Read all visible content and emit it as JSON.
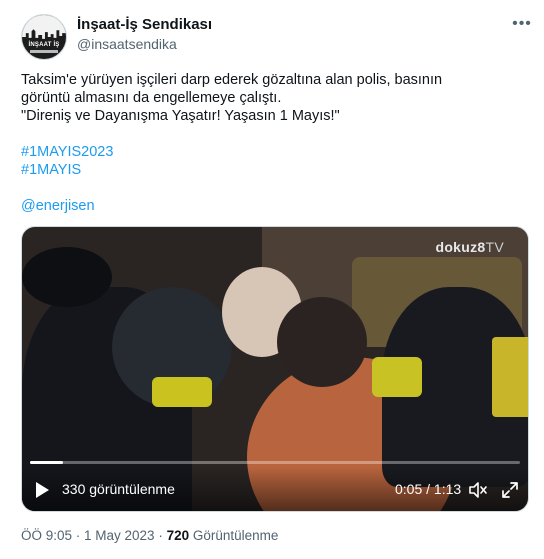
{
  "author": {
    "display_name": "İnşaat-İş Sendikası",
    "handle": "@insaatsendika",
    "avatar_label": "İNŞAAT İŞ"
  },
  "more_icon": "more-dots-icon",
  "tweet": {
    "line1": "Taksim'e yürüyen  işçileri darp ederek gözaltına alan polis, basının",
    "line2": "görüntü almasını da engellemeye çalıştı.",
    "line3": "\"Direniş ve Dayanışma Yaşatır! Yaşasın 1 Mayıs!\"",
    "hashtag1": "#1MAYIS2023",
    "hashtag2": "#1MAYIS",
    "mention": "@enerjisen"
  },
  "video": {
    "watermark": "dokuz8",
    "watermark_suffix": "TV",
    "views_label": "330 görüntülenme",
    "time_label": "0:05 / 1:13",
    "progress_fraction": 0.068,
    "icons": [
      "play-icon",
      "mute-icon",
      "fullscreen-icon"
    ]
  },
  "footer": {
    "timestamp": "ÖÖ 9:05 · 1 May 2023 · ",
    "view_count": "720",
    "view_word": " Görüntülenme"
  },
  "colors": {
    "link": "#1d9bf0",
    "secondary_text": "#536471",
    "primary_text": "#0f1419"
  }
}
